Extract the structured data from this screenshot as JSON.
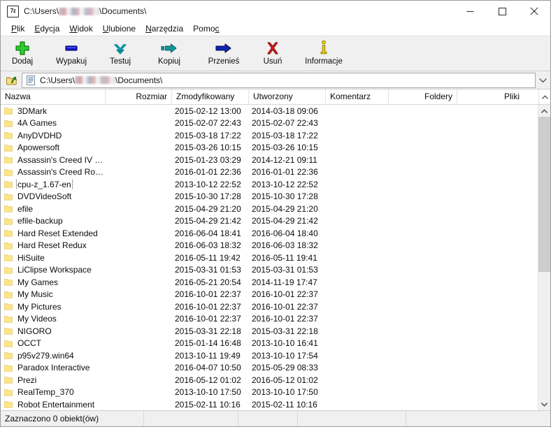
{
  "window": {
    "app_icon_label": "7z",
    "title_prefix": "C:\\Users\\",
    "title_redacted": "",
    "title_suffix": "\\Documents\\",
    "minimize_icon": "minimize-icon",
    "maximize_icon": "maximize-icon",
    "close_icon": "close-icon"
  },
  "menubar": {
    "items": [
      {
        "label": "Plik",
        "accel": "P",
        "rest": "lik"
      },
      {
        "label": "Edycja",
        "accel": "E",
        "rest": "dycja"
      },
      {
        "label": "Widok",
        "accel": "W",
        "rest": "idok"
      },
      {
        "label": "Ulubione",
        "accel": "U",
        "rest": "lubione"
      },
      {
        "label": "Narzędzia",
        "accel": "N",
        "rest": "arzędzia"
      },
      {
        "label": "Pomoc",
        "accel": "c",
        "rest": "Pomo"
      }
    ]
  },
  "toolbar": {
    "buttons": [
      {
        "label": "Dodaj",
        "icon": "plus-icon",
        "color": "#22c022"
      },
      {
        "label": "Wypakuj",
        "icon": "extract-icon",
        "color": "#1818d8"
      },
      {
        "label": "Testuj",
        "icon": "test-chevron-icon",
        "color": "#00a0b4"
      },
      {
        "label": "Kopiuj",
        "icon": "copy-arrow-icon",
        "color": "#0e8f92"
      },
      {
        "label": "Przenieś",
        "icon": "move-arrow-icon",
        "color": "#0c24a8"
      },
      {
        "label": "Usuń",
        "icon": "delete-x-icon",
        "color": "#d41414"
      },
      {
        "label": "Informacje",
        "icon": "info-icon",
        "color": "#e0c000"
      }
    ]
  },
  "address": {
    "up_icon": "up-folder-icon",
    "path_icon": "folder-properties-icon",
    "path_prefix": "C:\\Users\\",
    "path_redacted": "",
    "path_suffix": "\\Documents\\",
    "dropdown_icon": "chevron-down-icon"
  },
  "list": {
    "columns": [
      {
        "key": "name",
        "label": "Nazwa",
        "align": "left"
      },
      {
        "key": "size",
        "label": "Rozmiar",
        "align": "right"
      },
      {
        "key": "modified",
        "label": "Zmodyfikowany",
        "align": "left"
      },
      {
        "key": "created",
        "label": "Utworzony",
        "align": "left"
      },
      {
        "key": "comment",
        "label": "Komentarz",
        "align": "left"
      },
      {
        "key": "folders",
        "label": "Foldery",
        "align": "right"
      },
      {
        "key": "files",
        "label": "Pliki",
        "align": "right"
      }
    ],
    "rows": [
      {
        "name": "3DMark",
        "size": "",
        "modified": "2015-02-12 13:00",
        "created": "2014-03-18 09:06",
        "comment": "",
        "folders": "",
        "files": "",
        "focused": false
      },
      {
        "name": "4A Games",
        "size": "",
        "modified": "2015-02-07 22:43",
        "created": "2015-02-07 22:43",
        "comment": "",
        "folders": "",
        "files": "",
        "focused": false
      },
      {
        "name": "AnyDVDHD",
        "size": "",
        "modified": "2015-03-18 17:22",
        "created": "2015-03-18 17:22",
        "comment": "",
        "folders": "",
        "files": "",
        "focused": false
      },
      {
        "name": "Apowersoft",
        "size": "",
        "modified": "2015-03-26 10:15",
        "created": "2015-03-26 10:15",
        "comment": "",
        "folders": "",
        "files": "",
        "focused": false
      },
      {
        "name": "Assassin's Creed IV Blac...",
        "size": "",
        "modified": "2015-01-23 03:29",
        "created": "2014-12-21 09:11",
        "comment": "",
        "folders": "",
        "files": "",
        "focused": false
      },
      {
        "name": "Assassin's Creed Rogue",
        "size": "",
        "modified": "2016-01-01 22:36",
        "created": "2016-01-01 22:36",
        "comment": "",
        "folders": "",
        "files": "",
        "focused": false
      },
      {
        "name": "cpu-z_1.67-en",
        "size": "",
        "modified": "2013-10-12 22:52",
        "created": "2013-10-12 22:52",
        "comment": "",
        "folders": "",
        "files": "",
        "focused": true
      },
      {
        "name": "DVDVideoSoft",
        "size": "",
        "modified": "2015-10-30 17:28",
        "created": "2015-10-30 17:28",
        "comment": "",
        "folders": "",
        "files": "",
        "focused": false
      },
      {
        "name": "efile",
        "size": "",
        "modified": "2015-04-29 21:20",
        "created": "2015-04-29 21:20",
        "comment": "",
        "folders": "",
        "files": "",
        "focused": false
      },
      {
        "name": "efile-backup",
        "size": "",
        "modified": "2015-04-29 21:42",
        "created": "2015-04-29 21:42",
        "comment": "",
        "folders": "",
        "files": "",
        "focused": false
      },
      {
        "name": "Hard Reset Extended",
        "size": "",
        "modified": "2016-06-04 18:41",
        "created": "2016-06-04 18:40",
        "comment": "",
        "folders": "",
        "files": "",
        "focused": false
      },
      {
        "name": "Hard Reset Redux",
        "size": "",
        "modified": "2016-06-03 18:32",
        "created": "2016-06-03 18:32",
        "comment": "",
        "folders": "",
        "files": "",
        "focused": false
      },
      {
        "name": "HiSuite",
        "size": "",
        "modified": "2016-05-11 19:42",
        "created": "2016-05-11 19:41",
        "comment": "",
        "folders": "",
        "files": "",
        "focused": false
      },
      {
        "name": "LiClipse Workspace",
        "size": "",
        "modified": "2015-03-31 01:53",
        "created": "2015-03-31 01:53",
        "comment": "",
        "folders": "",
        "files": "",
        "focused": false
      },
      {
        "name": "My Games",
        "size": "",
        "modified": "2016-05-21 20:54",
        "created": "2014-11-19 17:47",
        "comment": "",
        "folders": "",
        "files": "",
        "focused": false
      },
      {
        "name": "My Music",
        "size": "",
        "modified": "2016-10-01 22:37",
        "created": "2016-10-01 22:37",
        "comment": "",
        "folders": "",
        "files": "",
        "focused": false
      },
      {
        "name": "My Pictures",
        "size": "",
        "modified": "2016-10-01 22:37",
        "created": "2016-10-01 22:37",
        "comment": "",
        "folders": "",
        "files": "",
        "focused": false
      },
      {
        "name": "My Videos",
        "size": "",
        "modified": "2016-10-01 22:37",
        "created": "2016-10-01 22:37",
        "comment": "",
        "folders": "",
        "files": "",
        "focused": false
      },
      {
        "name": "NIGORO",
        "size": "",
        "modified": "2015-03-31 22:18",
        "created": "2015-03-31 22:18",
        "comment": "",
        "folders": "",
        "files": "",
        "focused": false
      },
      {
        "name": "OCCT",
        "size": "",
        "modified": "2015-01-14 16:48",
        "created": "2013-10-10 16:41",
        "comment": "",
        "folders": "",
        "files": "",
        "focused": false
      },
      {
        "name": "p95v279.win64",
        "size": "",
        "modified": "2013-10-11 19:49",
        "created": "2013-10-10 17:54",
        "comment": "",
        "folders": "",
        "files": "",
        "focused": false
      },
      {
        "name": "Paradox Interactive",
        "size": "",
        "modified": "2016-04-07 10:50",
        "created": "2015-05-29 08:33",
        "comment": "",
        "folders": "",
        "files": "",
        "focused": false
      },
      {
        "name": "Prezi",
        "size": "",
        "modified": "2016-05-12 01:02",
        "created": "2016-05-12 01:02",
        "comment": "",
        "folders": "",
        "files": "",
        "focused": false
      },
      {
        "name": "RealTemp_370",
        "size": "",
        "modified": "2013-10-10 17:50",
        "created": "2013-10-10 17:50",
        "comment": "",
        "folders": "",
        "files": "",
        "focused": false
      },
      {
        "name": "Robot Entertainment",
        "size": "",
        "modified": "2015-02-11 10:16",
        "created": "2015-02-11 10:16",
        "comment": "",
        "folders": "",
        "files": "",
        "focused": false
      }
    ],
    "scrollbar": {
      "up_icon": "scroll-up-icon",
      "down_icon": "scroll-down-icon",
      "thumb_fraction": 55
    }
  },
  "statusbar": {
    "selection_text": "Zaznaczono 0 obiekt(ów)",
    "cell2": "",
    "cell3": "",
    "cell4": "",
    "cell5": ""
  },
  "colors": {
    "window_bg": "#ffffff",
    "chrome_bg": "#f0f0f0",
    "folder_yellow": "#fde68a",
    "folder_yellow_edge": "#e8cc6a",
    "text": "#0b0b0b"
  }
}
